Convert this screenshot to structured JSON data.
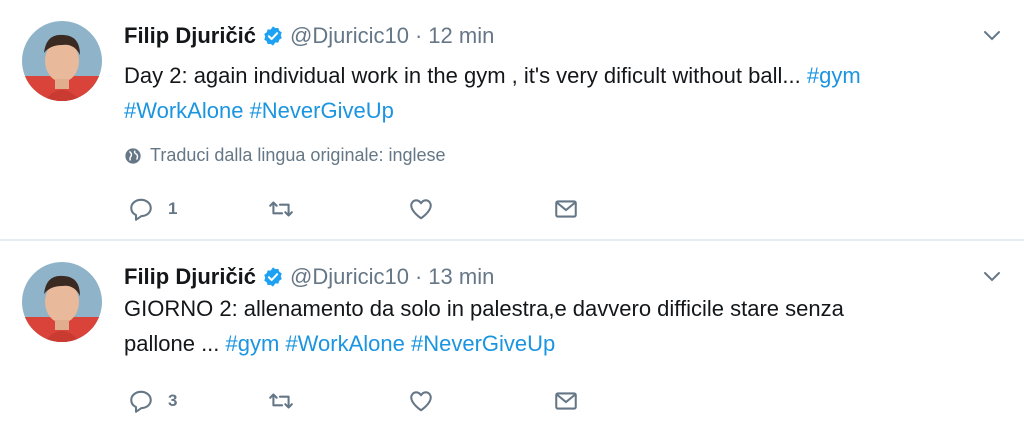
{
  "tweets": [
    {
      "name": "Filip Djuričić",
      "handle": "@Djuricic10",
      "separator": "·",
      "time": "12 min",
      "text_line1": "Day 2: again individual work in the gym , it's very dificult without ball... ",
      "tag1": "#gym",
      "tag2": "#WorkAlone",
      "tag3": "#NeverGiveUp",
      "translate": "Traduci dalla lingua originale: inglese",
      "reply_count": "1"
    },
    {
      "name": "Filip Djuričić",
      "handle": "@Djuricic10",
      "separator": "·",
      "time": "13 min",
      "text_line1": "GIORNO 2: allenamento da solo in palestra,e davvero difficile stare  senza",
      "text_line2": "pallone ... ",
      "tag1": "#gym",
      "tag2": "#WorkAlone",
      "tag3": "#NeverGiveUp",
      "reply_count": "3"
    }
  ],
  "colors": {
    "accent": "#1b95e0",
    "muted": "#657786",
    "text": "#14171a",
    "verified": "#1da1f2"
  }
}
